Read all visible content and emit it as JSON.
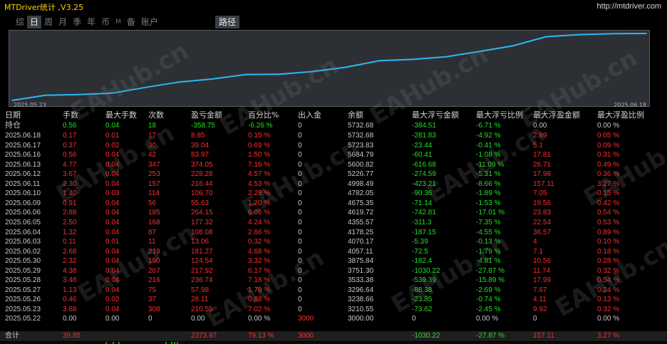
{
  "window": {
    "title": "MTDriver统计 ,V3.25",
    "url": "http://mtdriver.com"
  },
  "tabs": [
    {
      "label": "综",
      "active": false
    },
    {
      "label": "日",
      "active": true
    },
    {
      "label": "周",
      "active": false
    },
    {
      "label": "月",
      "active": false
    },
    {
      "label": "季",
      "active": false
    },
    {
      "label": "年",
      "active": false
    },
    {
      "label": "币",
      "active": false
    },
    {
      "label": "M",
      "active": false
    },
    {
      "label": "备",
      "active": false
    },
    {
      "label": "账户",
      "active": false
    }
  ],
  "route_tab": "路径",
  "chart_data": {
    "type": "line",
    "x": [
      "2025.05.22",
      "2025.05.23",
      "2025.05.26",
      "2025.05.27",
      "2025.05.28",
      "2025.05.29",
      "2025.05.30",
      "2025.06.02",
      "2025.06.03",
      "2025.06.04",
      "2025.06.05",
      "2025.06.06",
      "2025.06.09",
      "2025.06.10",
      "2025.06.11",
      "2025.06.12",
      "2025.06.13",
      "2025.06.16",
      "2025.06.17",
      "2025.06.18"
    ],
    "y": [
      3000.0,
      3210.55,
      3238.66,
      3296.64,
      3533.38,
      3751.3,
      3875.84,
      4057.11,
      4070.17,
      4178.25,
      4355.57,
      4619.72,
      4675.35,
      4782.05,
      4998.49,
      5226.77,
      5600.82,
      5684.79,
      5723.83,
      5732.68
    ],
    "xlabel_start": "2025.05.23",
    "xlabel_end": "2025.06.18",
    "line_color": "#2fb6f0",
    "background": "#2c3035"
  },
  "table": {
    "headers": [
      "日期",
      "手数",
      "最大手数",
      "次数",
      "盈亏金额",
      "百分比%",
      "出入金",
      "余额",
      "最大浮亏金额",
      "最大浮亏比例",
      "最大浮盈金额",
      "最大浮盈比例"
    ],
    "holding": {
      "date": "持仓",
      "lots": "0.56",
      "max_lots": "0.04",
      "count": "18",
      "pnl": "-358.75",
      "pct": "-6.26 %",
      "io": "0",
      "balance": "5732.68",
      "max_loss": "-384.51",
      "max_loss_pct": "-6.71 %",
      "max_profit": "0.00",
      "max_profit_pct": "0.00 %"
    },
    "rows": [
      {
        "date": "2025.06.18",
        "lots": "0.17",
        "max_lots": "0.01",
        "count": "17",
        "pnl": "8.85",
        "pct": "0.15 %",
        "io": "0",
        "balance": "5732.68",
        "max_loss": "-281.83",
        "max_loss_pct": "-4.92 %",
        "max_profit": "2.99",
        "max_profit_pct": "0.05 %"
      },
      {
        "date": "2025.06.17",
        "lots": "0.37",
        "max_lots": "0.02",
        "count": "30",
        "pnl": "39.04",
        "pct": "0.69 %",
        "io": "0",
        "balance": "5723.83",
        "max_loss": "-23.44",
        "max_loss_pct": "-0.41 %",
        "max_profit": "5.1",
        "max_profit_pct": "0.09 %"
      },
      {
        "date": "2025.06.16",
        "lots": "0.56",
        "max_lots": "0.04",
        "count": "42",
        "pnl": "83.97",
        "pct": "1.50 %",
        "io": "0",
        "balance": "5684.79",
        "max_loss": "-60.41",
        "max_loss_pct": "-1.08 %",
        "max_profit": "17.81",
        "max_profit_pct": "0.31 %"
      },
      {
        "date": "2025.06.13",
        "lots": "4.77",
        "max_lots": "0.04",
        "count": "347",
        "pnl": "374.05",
        "pct": "7.16 %",
        "io": "0",
        "balance": "5600.82",
        "max_loss": "-616.68",
        "max_loss_pct": "-11.09 %",
        "max_profit": "26.71",
        "max_profit_pct": "0.49 %"
      },
      {
        "date": "2025.06.12",
        "lots": "3.67",
        "max_lots": "0.04",
        "count": "253",
        "pnl": "228.28",
        "pct": "4.57 %",
        "io": "0",
        "balance": "5226.77",
        "max_loss": "-274.59",
        "max_loss_pct": "-5.31 %",
        "max_profit": "17.98",
        "max_profit_pct": "0.36 %"
      },
      {
        "date": "2025.06.11",
        "lots": "2.30",
        "max_lots": "0.04",
        "count": "157",
        "pnl": "216.44",
        "pct": "4.53 %",
        "io": "0",
        "balance": "4998.49",
        "max_loss": "-423.21",
        "max_loss_pct": "-8.66 %",
        "max_profit": "157.11",
        "max_profit_pct": "3.27 %"
      },
      {
        "date": "2025.06.10",
        "lots": "1.40",
        "max_lots": "0.03",
        "count": "114",
        "pnl": "106.70",
        "pct": "2.28 %",
        "io": "0",
        "balance": "4782.05",
        "max_loss": "-90.36",
        "max_loss_pct": "-1.89 %",
        "max_profit": "7.05",
        "max_profit_pct": "0.15 %"
      },
      {
        "date": "2025.06.09",
        "lots": "0.91",
        "max_lots": "0.04",
        "count": "56",
        "pnl": "55.63",
        "pct": "1.20 %",
        "io": "0",
        "balance": "4675.35",
        "max_loss": "-71.14",
        "max_loss_pct": "-1.53 %",
        "max_profit": "19.56",
        "max_profit_pct": "0.42 %"
      },
      {
        "date": "2025.06.06",
        "lots": "2.88",
        "max_lots": "0.04",
        "count": "185",
        "pnl": "264.15",
        "pct": "6.06 %",
        "io": "0",
        "balance": "4619.72",
        "max_loss": "-742.81",
        "max_loss_pct": "-17.01 %",
        "max_profit": "23.83",
        "max_profit_pct": "0.54 %"
      },
      {
        "date": "2025.06.05",
        "lots": "2.50",
        "max_lots": "0.04",
        "count": "168",
        "pnl": "177.32",
        "pct": "4.24 %",
        "io": "0",
        "balance": "4355.57",
        "max_loss": "-311.3",
        "max_loss_pct": "-7.35 %",
        "max_profit": "22.54",
        "max_profit_pct": "0.53 %"
      },
      {
        "date": "2025.06.04",
        "lots": "1.32",
        "max_lots": "0.04",
        "count": "87",
        "pnl": "108.08",
        "pct": "2.66 %",
        "io": "0",
        "balance": "4178.25",
        "max_loss": "-187.15",
        "max_loss_pct": "-4.55 %",
        "max_profit": "36.57",
        "max_profit_pct": "0.89 %"
      },
      {
        "date": "2025.06.03",
        "lots": "0.11",
        "max_lots": "0.01",
        "count": "11",
        "pnl": "13.06",
        "pct": "0.32 %",
        "io": "0",
        "balance": "4070.17",
        "max_loss": "-5.39",
        "max_loss_pct": "-0.13 %",
        "max_profit": "4",
        "max_profit_pct": "0.10 %"
      },
      {
        "date": "2025.06.02",
        "lots": "2.68",
        "max_lots": "0.04",
        "count": "219",
        "pnl": "181.27",
        "pct": "4.68 %",
        "io": "0",
        "balance": "4057.11",
        "max_loss": "-72.5",
        "max_loss_pct": "-1.79 %",
        "max_profit": "7.1",
        "max_profit_pct": "0.18 %"
      },
      {
        "date": "2025.05.30",
        "lots": "2.32",
        "max_lots": "0.04",
        "count": "150",
        "pnl": "124.54",
        "pct": "3.32 %",
        "io": "0",
        "balance": "3875.84",
        "max_loss": "-182.4",
        "max_loss_pct": "-4.81 %",
        "max_profit": "10.56",
        "max_profit_pct": "0.28 %"
      },
      {
        "date": "2025.05.29",
        "lots": "4.38",
        "max_lots": "0.04",
        "count": "267",
        "pnl": "217.92",
        "pct": "6.17 %",
        "io": "0",
        "balance": "3751.30",
        "max_loss": "-1030.22",
        "max_loss_pct": "-27.87 %",
        "max_profit": "11.74",
        "max_profit_pct": "0.32 %"
      },
      {
        "date": "2025.05.28",
        "lots": "3.48",
        "max_lots": "0.04",
        "count": "216",
        "pnl": "236.74",
        "pct": "7.18 %",
        "io": "0",
        "balance": "3533.38",
        "max_loss": "-539.39",
        "max_loss_pct": "-15.89 %",
        "max_profit": "17.99",
        "max_profit_pct": "0.54 %"
      },
      {
        "date": "2025.05.27",
        "lots": "1.13",
        "max_lots": "0.04",
        "count": "75",
        "pnl": "57.98",
        "pct": "1.79 %",
        "io": "0",
        "balance": "3296.64",
        "max_loss": "-88.38",
        "max_loss_pct": "-2.69 %",
        "max_profit": "7.67",
        "max_profit_pct": "0.24 %"
      },
      {
        "date": "2025.05.26",
        "lots": "0.46",
        "max_lots": "0.02",
        "count": "37",
        "pnl": "28.11",
        "pct": "0.88 %",
        "io": "0",
        "balance": "3238.66",
        "max_loss": "-23.85",
        "max_loss_pct": "-0.74 %",
        "max_profit": "4.11",
        "max_profit_pct": "0.13 %"
      },
      {
        "date": "2025.05.23",
        "lots": "3.88",
        "max_lots": "0.04",
        "count": "308",
        "pnl": "210.55",
        "pct": "7.02 %",
        "io": "0",
        "balance": "3210.55",
        "max_loss": "-73.62",
        "max_loss_pct": "-2.45 %",
        "max_profit": "9.92",
        "max_profit_pct": "0.32 %"
      },
      {
        "date": "2025.05.22",
        "lots": "0.00",
        "max_lots": "0.00",
        "count": "0",
        "pnl": "0.00",
        "pct": "0.00 %",
        "io": "3000",
        "balance": "3000.00",
        "max_loss": "0",
        "max_loss_pct": "0.00 %",
        "max_profit": "0",
        "max_profit_pct": "0.00 %"
      }
    ],
    "total": {
      "date": "合计",
      "lots": "39.85",
      "max_lots": "",
      "count": "",
      "pnl": "2373.97",
      "pct": "79.13 %",
      "io": "3000",
      "balance": "",
      "max_loss": "-1030.22",
      "max_loss_pct": "-27.87 %",
      "max_profit": "157.11",
      "max_profit_pct": "3.27 %"
    }
  },
  "colors": {
    "title": "#ffd000",
    "loss": "#ff2b2b",
    "gain": "#20e020",
    "neutral": "#c8c8c8"
  },
  "watermark": "EAHub.cn"
}
